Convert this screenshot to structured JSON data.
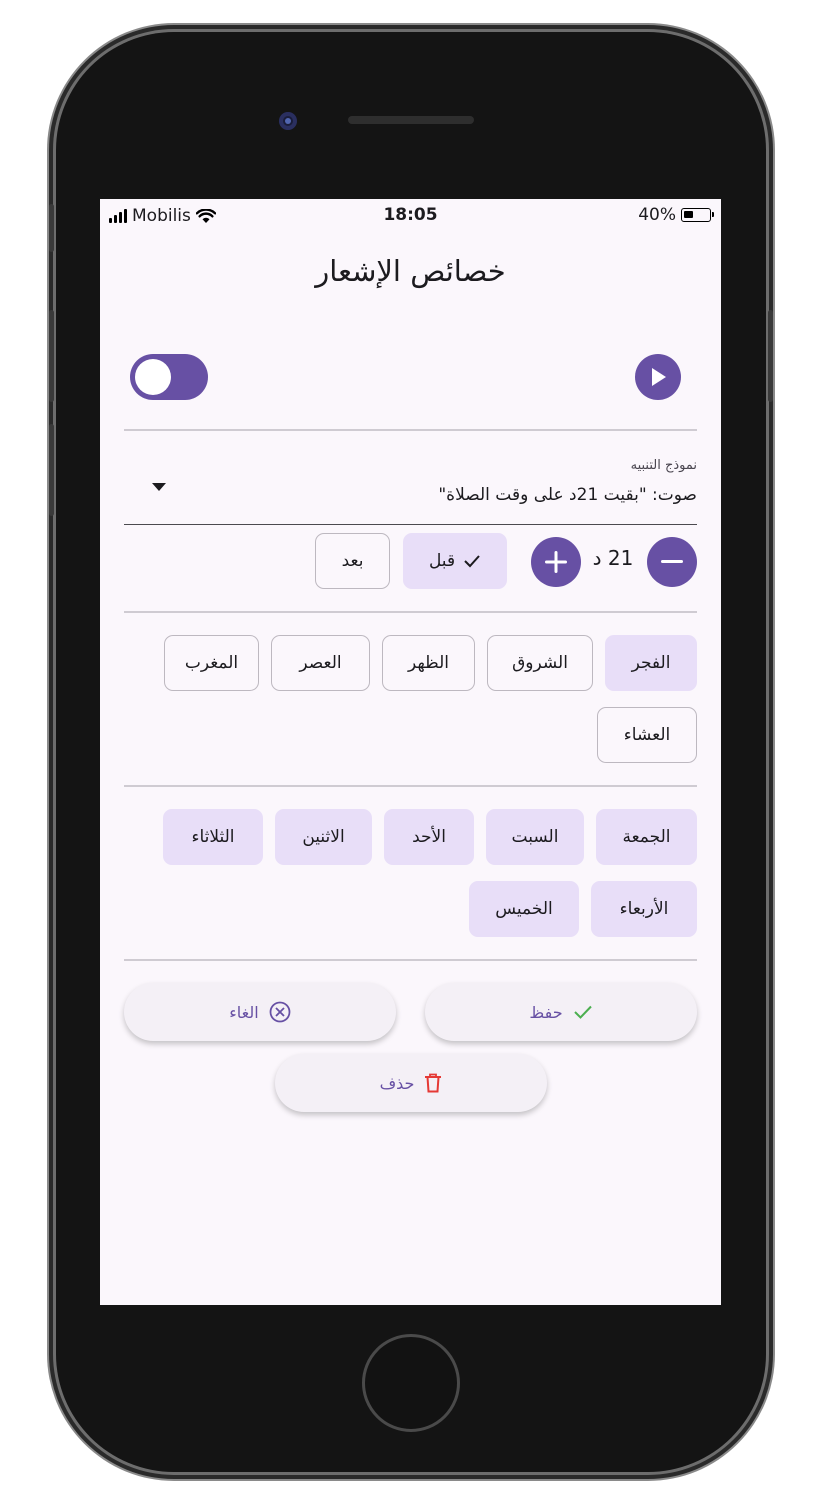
{
  "status_bar": {
    "carrier": "Mobilis",
    "time": "18:05",
    "battery_percent": "40%",
    "battery_level": 0.4
  },
  "page": {
    "title": "خصائص الإشعار"
  },
  "enable_toggle": {
    "on": true
  },
  "alert_template": {
    "label": "نموذج التنبيه",
    "value": "صوت: \"بقيت 21د على وقت الصلاة\""
  },
  "offset": {
    "minutes_text": "21 د",
    "before_label": "قبل",
    "after_label": "بعد",
    "selected": "before"
  },
  "prayers": [
    {
      "label": "الفجر",
      "selected": true
    },
    {
      "label": "الشروق",
      "selected": false
    },
    {
      "label": "الظهر",
      "selected": false
    },
    {
      "label": "العصر",
      "selected": false
    },
    {
      "label": "المغرب",
      "selected": false
    },
    {
      "label": "العشاء",
      "selected": false
    }
  ],
  "days": [
    {
      "label": "الجمعة",
      "selected": true
    },
    {
      "label": "السبت",
      "selected": true
    },
    {
      "label": "الأحد",
      "selected": true
    },
    {
      "label": "الاثنين",
      "selected": true
    },
    {
      "label": "الثلاثاء",
      "selected": true
    },
    {
      "label": "الأربعاء",
      "selected": true
    },
    {
      "label": "الخميس",
      "selected": true
    }
  ],
  "actions": {
    "save_label": "حفظ",
    "cancel_label": "الغاء",
    "delete_label": "حذف"
  },
  "colors": {
    "primary": "#6750a4",
    "chip_selected": "#e8def8",
    "screen_bg": "#fbf7fc",
    "save_check": "#4caf50",
    "delete_red": "#e53935"
  }
}
